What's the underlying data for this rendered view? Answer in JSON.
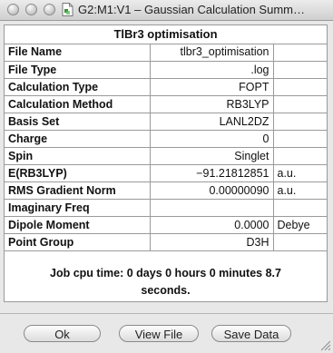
{
  "window": {
    "title": "G2:M1:V1 – Gaussian Calculation Summ…"
  },
  "panel": {
    "title": "TlBr3 optimisation",
    "rows": [
      {
        "label": "File Name",
        "value": "tlbr3_optimisation",
        "unit": ""
      },
      {
        "label": "File Type",
        "value": ".log",
        "unit": ""
      },
      {
        "label": "Calculation Type",
        "value": "FOPT",
        "unit": ""
      },
      {
        "label": "Calculation Method",
        "value": "RB3LYP",
        "unit": ""
      },
      {
        "label": "Basis Set",
        "value": "LANL2DZ",
        "unit": ""
      },
      {
        "label": "Charge",
        "value": "0",
        "unit": ""
      },
      {
        "label": "Spin",
        "value": "Singlet",
        "unit": ""
      },
      {
        "label": "E(RB3LYP)",
        "value": "−91.21812851",
        "unit": "a.u."
      },
      {
        "label": "RMS Gradient Norm",
        "value": "0.00000090",
        "unit": "a.u."
      },
      {
        "label": "Imaginary Freq",
        "value": "",
        "unit": ""
      },
      {
        "label": "Dipole Moment",
        "value": "0.0000",
        "unit": "Debye"
      },
      {
        "label": "Point Group",
        "value": "D3H",
        "unit": ""
      }
    ],
    "cpu_line1": "Job cpu time:  0 days  0 hours  0 minutes  8.7",
    "cpu_line2": "seconds."
  },
  "buttons": {
    "ok": "Ok",
    "view_file": "View File",
    "save_data": "Save Data"
  }
}
